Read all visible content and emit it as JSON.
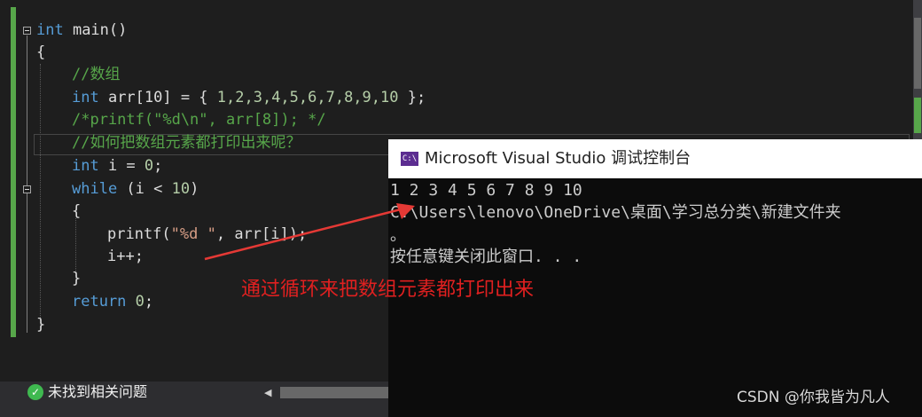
{
  "editor": {
    "code_lines": {
      "l1_kw": "int",
      "l1_rest": " main()",
      "l2": "{",
      "l3": "//数组",
      "l4_kw": "int",
      "l4_rest": " arr[10] = { ",
      "l4_nums": "1,2,3,4,5,6,7,8,9,10",
      "l4_end": " };",
      "l5": "/*printf(\"%d\\n\", arr[8]); */",
      "l6": "//如何把数组元素都打印出来呢？",
      "l7_kw": "int",
      "l7_rest": " i = ",
      "l7_num": "0",
      "l7_end": ";",
      "l8_kw": "while",
      "l8_rest": " (i < ",
      "l8_num": "10",
      "l8_end": ")",
      "l9": "{",
      "l10_fn": "printf(",
      "l10_str": "\"%d \"",
      "l10_rest": ", arr[i]);",
      "l11": "i++;",
      "l12": "}",
      "l13_kw": "return",
      "l13_rest": " ",
      "l13_num": "0",
      "l13_end": ";",
      "l14": "}"
    }
  },
  "status": {
    "text": "未找到相关问题",
    "icon": "check-circle-icon"
  },
  "console": {
    "icon_label": "C:\\",
    "title": "Microsoft Visual Studio 调试控制台",
    "lines": [
      "1 2 3 4 5 6 7 8 9 10",
      "C:\\Users\\lenovo\\OneDrive\\桌面\\学习总分类\\新建文件夹",
      "。",
      "按任意键关闭此窗口. . ."
    ]
  },
  "annotation": {
    "text": "通过循环来把数组元素都打印出来",
    "color": "#e02020"
  },
  "watermark": "CSDN @你我皆为凡人",
  "colors": {
    "editor_bg": "#1e1e1e",
    "keyword": "#569cd6",
    "comment": "#57a64a",
    "number": "#b5cea8",
    "string": "#d69d85",
    "console_bg": "#0c0c0c"
  }
}
